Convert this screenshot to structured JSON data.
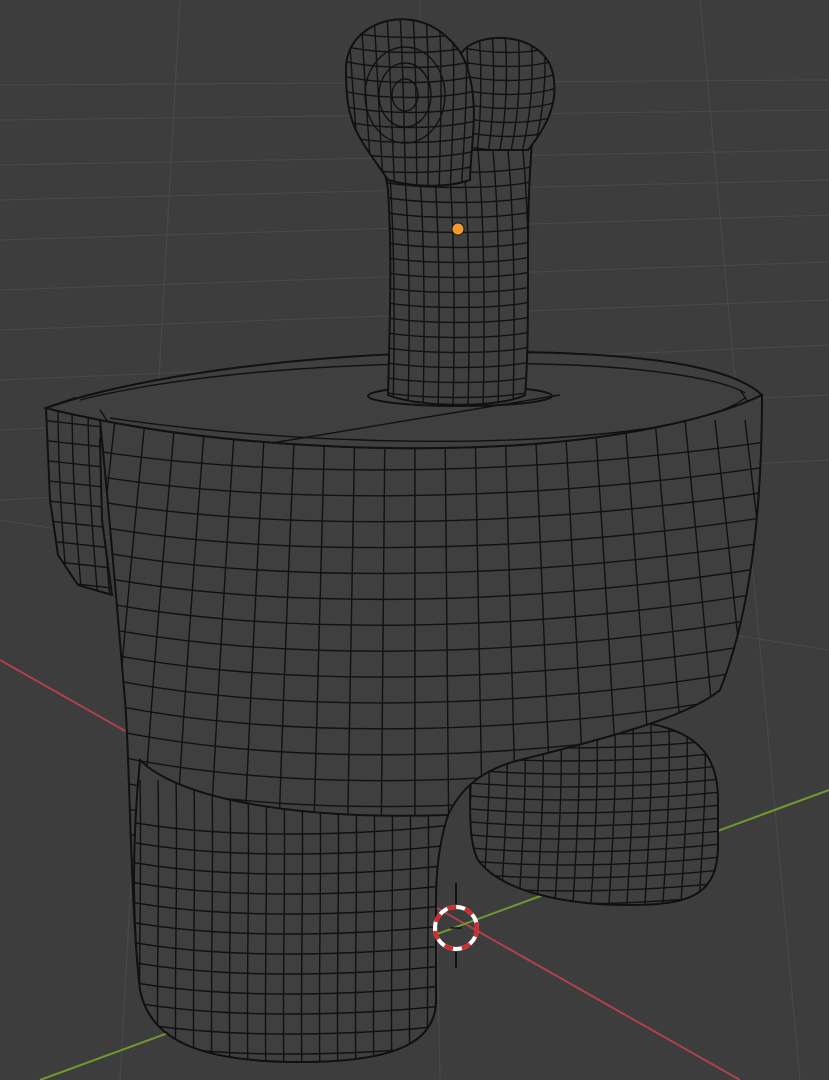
{
  "viewport": {
    "background_color": "#3d3d3d",
    "grid_line_color": "#4a4a4a",
    "x_axis_color": "#b0404e",
    "y_axis_color": "#6e9a2e",
    "mesh_fill_color": "#3f3f3f",
    "mesh_shade_color": "#333333",
    "wire_color": "#111111",
    "origin_dot_color": "#f29a2e",
    "cursor_ring_red": "#d42a2a",
    "cursor_ring_white": "#ffffff"
  },
  "mesh": {
    "object_type": "character-body-with-stalk",
    "wireframe_overlay": true
  },
  "cursor": {
    "icon": "3d-cursor-icon"
  },
  "origin": {
    "icon": "object-origin-dot-icon"
  }
}
